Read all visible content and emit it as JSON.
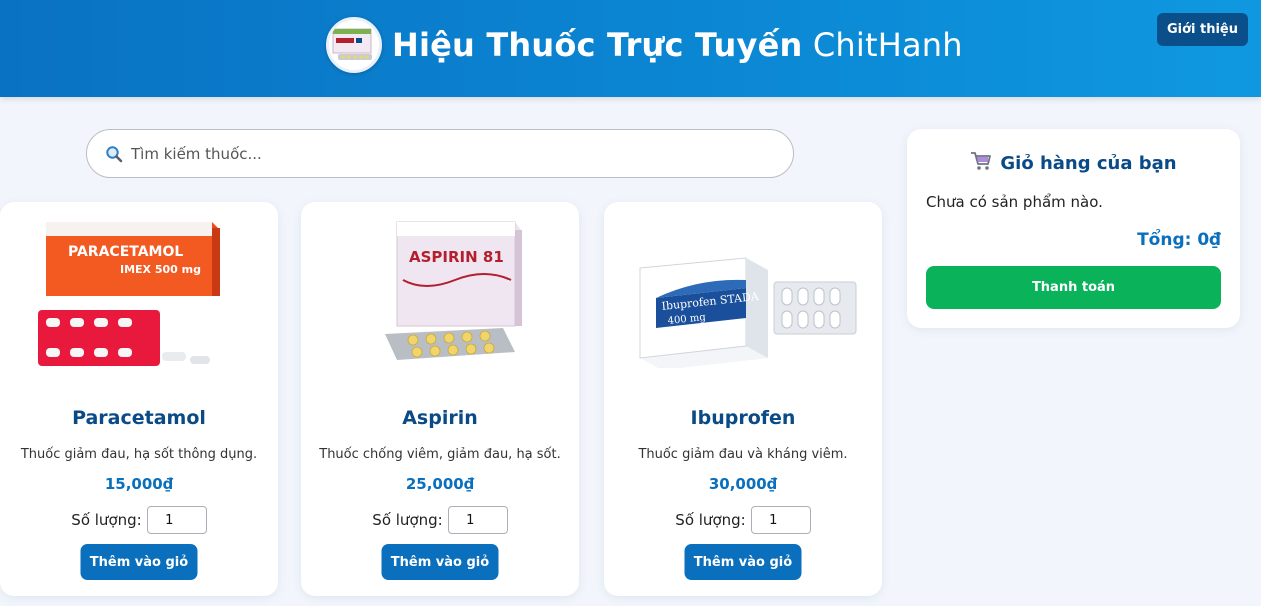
{
  "header": {
    "title_bold": "Hiệu Thuốc Trực Tuyến",
    "title_regular": "ChitHanh",
    "logo_icon": "aspirin-box-logo",
    "about_label": "Giới thiệu"
  },
  "search": {
    "icon": "magnifier-icon",
    "placeholder": "Tìm kiếm thuốc..."
  },
  "products": [
    {
      "name": "Paracetamol",
      "description": "Thuốc giảm đau, hạ sốt thông dụng.",
      "price": "15,000₫",
      "qty_label": "Số lượng:",
      "qty_value": "1",
      "button": "Thêm vào giỏ",
      "box_text_1": "PARACETAMOL",
      "box_text_2": "IMEX 500 mg"
    },
    {
      "name": "Aspirin",
      "description": "Thuốc chống viêm, giảm đau, hạ sốt.",
      "price": "25,000₫",
      "qty_label": "Số lượng:",
      "qty_value": "1",
      "button": "Thêm vào giỏ",
      "box_text_1": "ASPIRIN 81"
    },
    {
      "name": "Ibuprofen",
      "description": "Thuốc giảm đau và kháng viêm.",
      "price": "30,000₫",
      "qty_label": "Số lượng:",
      "qty_value": "1",
      "button": "Thêm vào giỏ",
      "box_text_1": "Ibuprofen STADA",
      "box_text_2": "400 mg"
    }
  ],
  "cart": {
    "icon": "shopping-cart-icon",
    "title": "Giỏ hàng của bạn",
    "empty_text": "Chưa có sản phẩm nào.",
    "total": "Tổng: 0₫",
    "checkout_label": "Thanh toán"
  },
  "colors": {
    "header_gradient_start": "#0a72c2",
    "header_gradient_end": "#0f98e0",
    "primary": "#0a6fbd",
    "heading": "#0a4a86",
    "checkout": "#0ab25a",
    "about_button": "#0b4f8a",
    "page_background": "#f2f6fc"
  }
}
